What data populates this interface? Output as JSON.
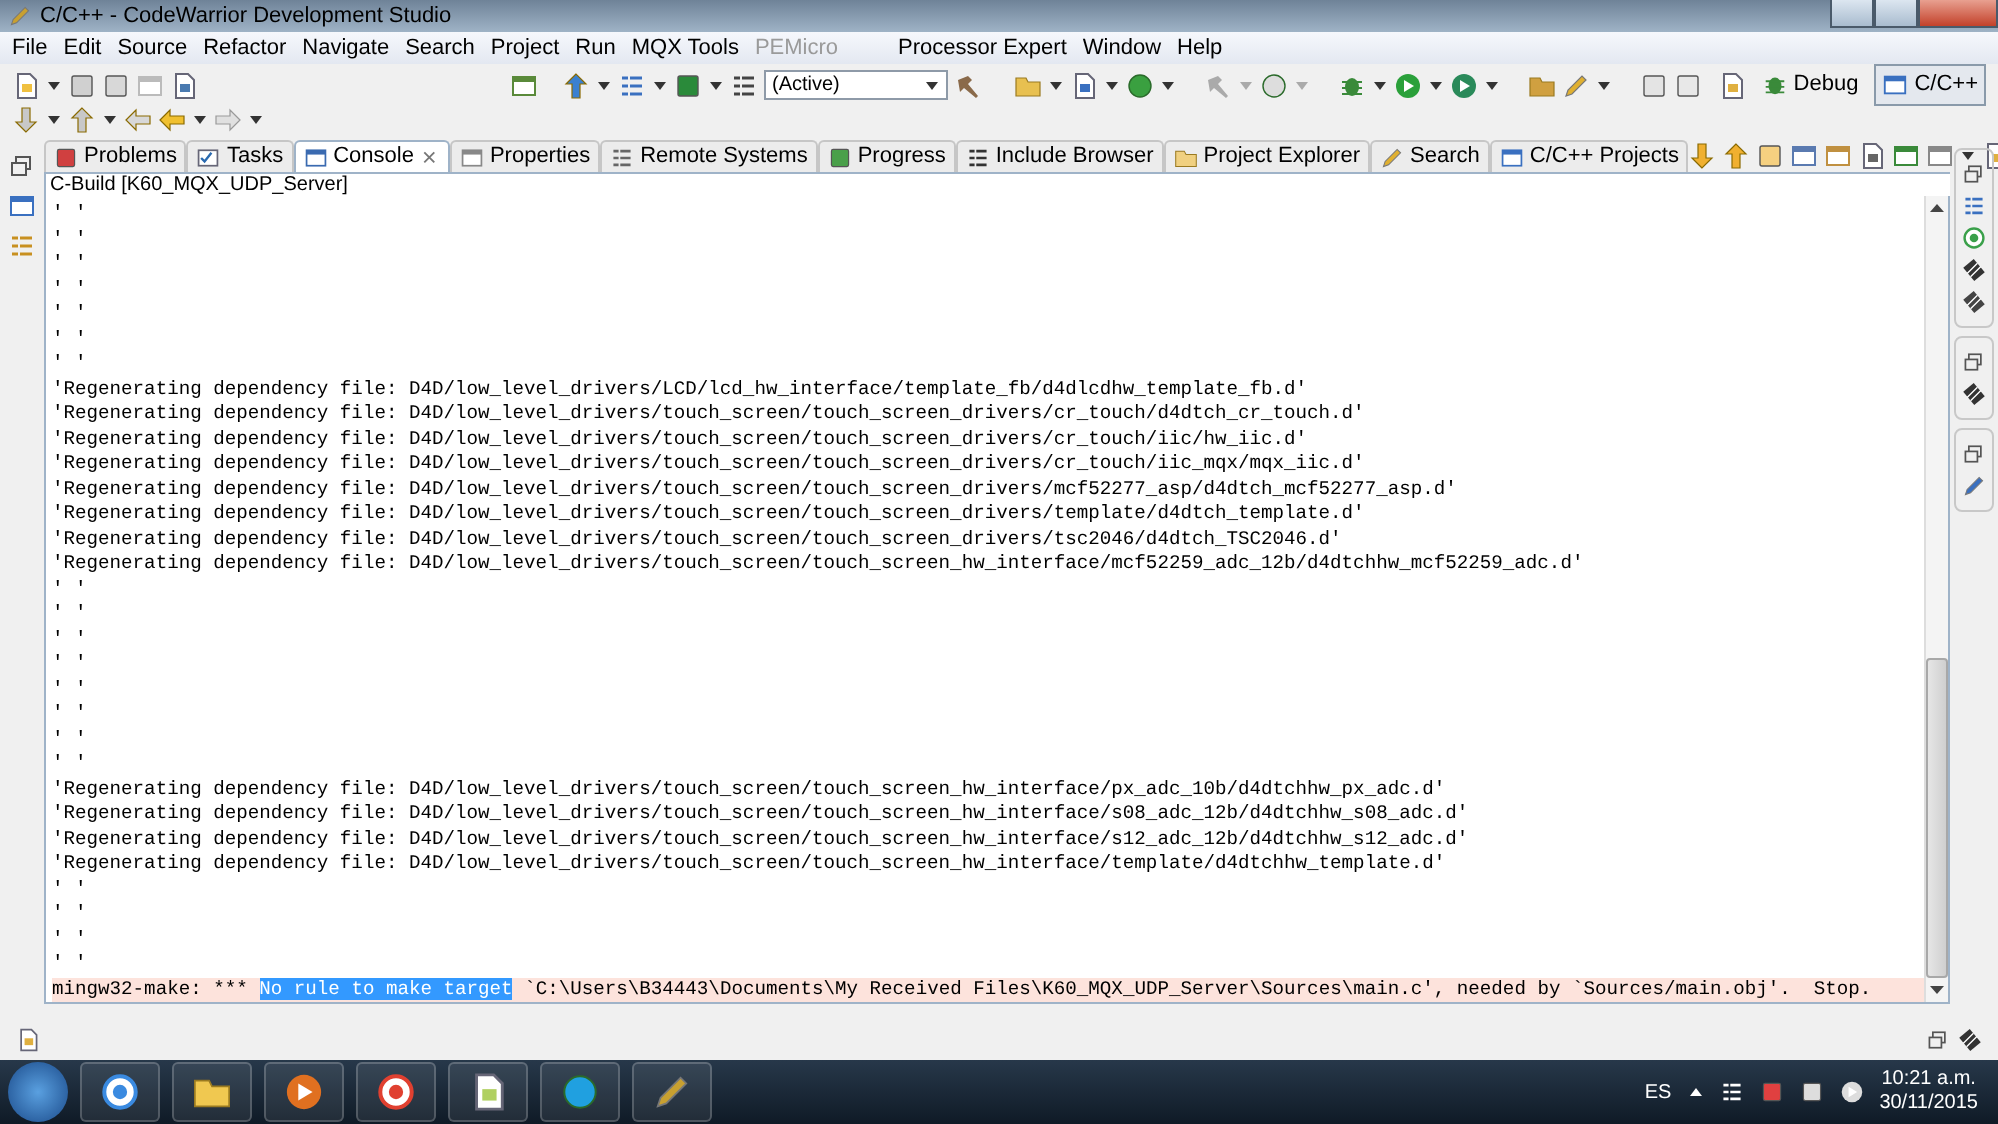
{
  "window": {
    "title": "C/C++ - CodeWarrior Development Studio"
  },
  "menu": [
    {
      "label": "File",
      "disabled": false
    },
    {
      "label": "Edit",
      "disabled": false
    },
    {
      "label": "Source",
      "disabled": false
    },
    {
      "label": "Refactor",
      "disabled": false
    },
    {
      "label": "Navigate",
      "disabled": false
    },
    {
      "label": "Search",
      "disabled": false
    },
    {
      "label": "Project",
      "disabled": false
    },
    {
      "label": "Run",
      "disabled": false
    },
    {
      "label": "MQX Tools",
      "disabled": false
    },
    {
      "label": "PEMicro",
      "disabled": true
    },
    {
      "label": "Processor Expert",
      "disabled": false
    },
    {
      "label": "Window",
      "disabled": false
    },
    {
      "label": "Help",
      "disabled": false
    }
  ],
  "toolbar": {
    "configuration": "(Active)"
  },
  "perspectives": [
    {
      "label": "Debug",
      "selected": false
    },
    {
      "label": "C/C++",
      "selected": true
    }
  ],
  "tabs": [
    {
      "label": "Problems",
      "selected": false
    },
    {
      "label": "Tasks",
      "selected": false
    },
    {
      "label": "Console",
      "selected": true
    },
    {
      "label": "Properties",
      "selected": false
    },
    {
      "label": "Remote Systems",
      "selected": false
    },
    {
      "label": "Progress",
      "selected": false
    },
    {
      "label": "Include Browser",
      "selected": false
    },
    {
      "label": "Project Explorer",
      "selected": false
    },
    {
      "label": "Search",
      "selected": false
    },
    {
      "label": "C/C++ Projects",
      "selected": false
    }
  ],
  "console": {
    "title": "C-Build [K60_MQX_UDP_Server]",
    "lines": [
      {
        "kind": "output",
        "text": "' '"
      },
      {
        "kind": "output",
        "text": "' '"
      },
      {
        "kind": "output",
        "text": "' '"
      },
      {
        "kind": "output",
        "text": "' '"
      },
      {
        "kind": "output",
        "text": "' '"
      },
      {
        "kind": "output",
        "text": "' '"
      },
      {
        "kind": "output",
        "text": "' '"
      },
      {
        "kind": "output",
        "text": "'Regenerating dependency file: D4D/low_level_drivers/LCD/lcd_hw_interface/template_fb/d4dlcdhw_template_fb.d'"
      },
      {
        "kind": "output",
        "text": "'Regenerating dependency file: D4D/low_level_drivers/touch_screen/touch_screen_drivers/cr_touch/d4dtch_cr_touch.d'"
      },
      {
        "kind": "output",
        "text": "'Regenerating dependency file: D4D/low_level_drivers/touch_screen/touch_screen_drivers/cr_touch/iic/hw_iic.d'"
      },
      {
        "kind": "output",
        "text": "'Regenerating dependency file: D4D/low_level_drivers/touch_screen/touch_screen_drivers/cr_touch/iic_mqx/mqx_iic.d'"
      },
      {
        "kind": "output",
        "text": "'Regenerating dependency file: D4D/low_level_drivers/touch_screen/touch_screen_drivers/mcf52277_asp/d4dtch_mcf52277_asp.d'"
      },
      {
        "kind": "output",
        "text": "'Regenerating dependency file: D4D/low_level_drivers/touch_screen/touch_screen_drivers/template/d4dtch_template.d'"
      },
      {
        "kind": "output",
        "text": "'Regenerating dependency file: D4D/low_level_drivers/touch_screen/touch_screen_drivers/tsc2046/d4dtch_TSC2046.d'"
      },
      {
        "kind": "output",
        "text": "'Regenerating dependency file: D4D/low_level_drivers/touch_screen/touch_screen_hw_interface/mcf52259_adc_12b/d4dtchhw_mcf52259_adc.d'"
      },
      {
        "kind": "output",
        "text": "' '"
      },
      {
        "kind": "output",
        "text": "' '"
      },
      {
        "kind": "output",
        "text": "' '"
      },
      {
        "kind": "output",
        "text": "' '"
      },
      {
        "kind": "output",
        "text": "' '"
      },
      {
        "kind": "output",
        "text": "' '"
      },
      {
        "kind": "output",
        "text": "' '"
      },
      {
        "kind": "output",
        "text": "' '"
      },
      {
        "kind": "output",
        "text": "'Regenerating dependency file: D4D/low_level_drivers/touch_screen/touch_screen_hw_interface/px_adc_10b/d4dtchhw_px_adc.d'"
      },
      {
        "kind": "output",
        "text": "'Regenerating dependency file: D4D/low_level_drivers/touch_screen/touch_screen_hw_interface/s08_adc_12b/d4dtchhw_s08_adc.d'"
      },
      {
        "kind": "output",
        "text": "'Regenerating dependency file: D4D/low_level_drivers/touch_screen/touch_screen_hw_interface/s12_adc_12b/d4dtchhw_s12_adc.d'"
      },
      {
        "kind": "output",
        "text": "'Regenerating dependency file: D4D/low_level_drivers/touch_screen/touch_screen_hw_interface/template/d4dtchhw_template.d'"
      },
      {
        "kind": "output",
        "text": "' '"
      },
      {
        "kind": "output",
        "text": "' '"
      },
      {
        "kind": "output",
        "text": "' '"
      },
      {
        "kind": "output",
        "text": "' '"
      },
      {
        "kind": "error",
        "prefix": "mingw32-make: *** ",
        "selected_text": "No rule to make target",
        "rest": " `C:\\Users\\B34443\\Documents\\My Received Files\\K60_MQX_UDP_Server\\Sources\\main.c', needed by `Sources/main.obj'.  Stop."
      }
    ]
  },
  "taskbar": {
    "language": "ES",
    "time": "10:21 a.m.",
    "date": "30/11/2015"
  }
}
